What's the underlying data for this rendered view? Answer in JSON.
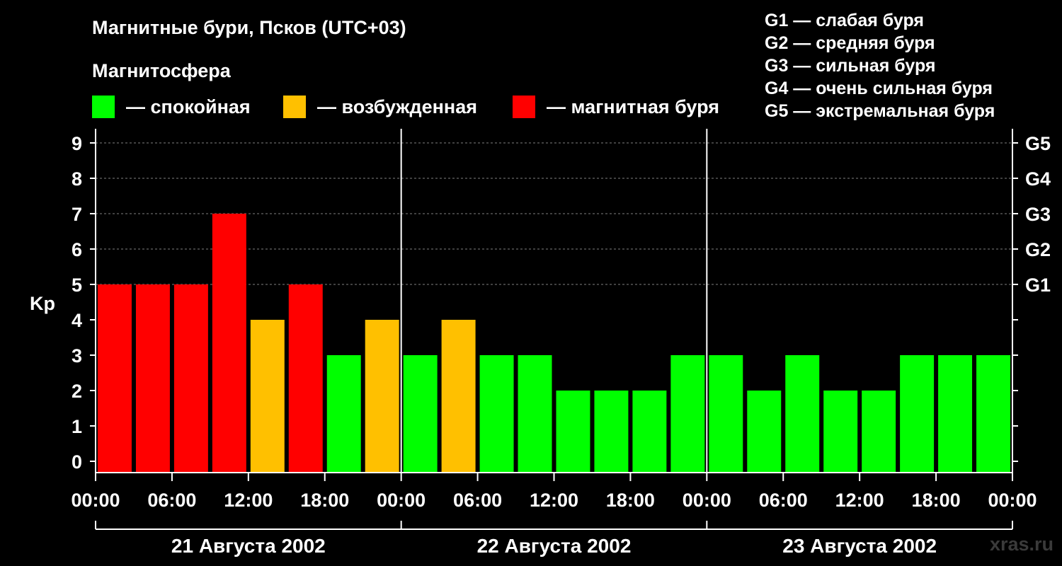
{
  "title": "Магнитные бури, Псков (UTC+03)",
  "subtitle": "Магнитосфера",
  "legend": [
    {
      "color": "#00ff00",
      "label": "— спокойная"
    },
    {
      "color": "#ffc000",
      "label": "— возбужденная"
    },
    {
      "color": "#ff0000",
      "label": "— магнитная буря"
    }
  ],
  "storm_levels": [
    "G1 — слабая буря",
    "G2 — средняя буря",
    "G3 — сильная буря",
    "G4 — очень сильная буря",
    "G5 — экстремальная буря"
  ],
  "watermark": "xras.ru",
  "colors": {
    "quiet": "#00ff00",
    "excited": "#ffc000",
    "storm": "#ff0000",
    "background": "#000000",
    "grid": "#808080"
  },
  "chart_data": {
    "type": "bar",
    "ylabel": "Kp",
    "ylim": [
      0,
      9
    ],
    "yticks": [
      "0",
      "1",
      "2",
      "3",
      "4",
      "5",
      "6",
      "7",
      "8",
      "9"
    ],
    "right_ticks": [
      {
        "kp": 5,
        "label": "G1"
      },
      {
        "kp": 6,
        "label": "G2"
      },
      {
        "kp": 7,
        "label": "G3"
      },
      {
        "kp": 8,
        "label": "G4"
      },
      {
        "kp": 9,
        "label": "G5"
      }
    ],
    "xticks": [
      "00:00",
      "06:00",
      "12:00",
      "18:00",
      "00:00",
      "06:00",
      "12:00",
      "18:00",
      "00:00",
      "06:00",
      "12:00",
      "18:00",
      "00:00"
    ],
    "days": [
      "21 Августа 2002",
      "22 Августа 2002",
      "23 Августа 2002"
    ],
    "interval_hours": 3,
    "values": [
      5,
      5,
      5,
      7,
      4,
      5,
      3,
      4,
      3,
      4,
      3,
      3,
      2,
      2,
      2,
      3,
      3,
      2,
      3,
      2,
      2,
      3,
      3,
      3
    ],
    "thresholds": {
      "excited": 4,
      "storm": 5
    },
    "grid": true
  }
}
